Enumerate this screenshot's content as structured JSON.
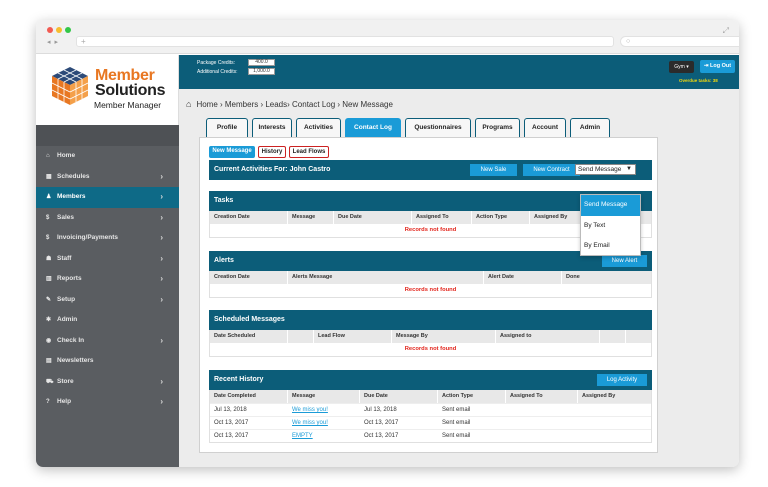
{
  "browser": {
    "nav": [
      "◂",
      "▸"
    ],
    "new_tab": "+",
    "search_icon": "○",
    "expand_icon": "⤢"
  },
  "brand": {
    "line1": "Member",
    "line2": "Solutions",
    "line3": "Member Manager"
  },
  "sidebar": {
    "items": [
      {
        "label": "Home",
        "icon": "home-icon",
        "glyph": "⌂",
        "chevron": false,
        "active": false
      },
      {
        "label": "Schedules",
        "icon": "calendar-icon",
        "glyph": "▦",
        "chevron": true,
        "active": false
      },
      {
        "label": "Members",
        "icon": "user-icon",
        "glyph": "♟",
        "chevron": true,
        "active": true
      },
      {
        "label": "Sales",
        "icon": "dollar-icon",
        "glyph": "$",
        "chevron": true,
        "active": false
      },
      {
        "label": "Invoicing/Payments",
        "icon": "dollar-icon",
        "glyph": "$",
        "chevron": true,
        "active": false
      },
      {
        "label": "Staff",
        "icon": "users-icon",
        "glyph": "☗",
        "chevron": true,
        "active": false
      },
      {
        "label": "Reports",
        "icon": "chart-icon",
        "glyph": "▥",
        "chevron": true,
        "active": false
      },
      {
        "label": "Setup",
        "icon": "wrench-icon",
        "glyph": "✎",
        "chevron": true,
        "active": false
      },
      {
        "label": "Admin",
        "icon": "gear-icon",
        "glyph": "✱",
        "chevron": false,
        "active": false
      },
      {
        "label": "Check In",
        "icon": "check-circle-icon",
        "glyph": "◉",
        "chevron": true,
        "active": false
      },
      {
        "label": "Newsletters",
        "icon": "newspaper-icon",
        "glyph": "▤",
        "chevron": false,
        "active": false
      },
      {
        "label": "Store",
        "icon": "cart-icon",
        "glyph": "⛟",
        "chevron": true,
        "active": false
      },
      {
        "label": "Help",
        "icon": "help-icon",
        "glyph": "?",
        "chevron": true,
        "active": false
      }
    ],
    "chevron_glyph": "›"
  },
  "topbar": {
    "package_label": "Package Credits:",
    "package_value": "400.0",
    "additional_label": "Additional Credits:",
    "additional_value": "1,000.0",
    "gym_label": "Gym ▾",
    "logout_label": "⇥ Log Out",
    "overdue": "Overdue tasks: 38"
  },
  "breadcrumb": {
    "home_glyph": "⌂",
    "path": "Home › Members › Leads› Contact Log › New Message"
  },
  "tabs": [
    "Profile",
    "Interests",
    "Activities",
    "Contact Log",
    "Questionnaires",
    "Programs",
    "Account",
    "Admin"
  ],
  "active_tab": "Contact Log",
  "subtabs": [
    "New Message",
    "History",
    "Lead Flows"
  ],
  "activities": {
    "title": "Current Activities For: John Castro",
    "new_sale": "New Sale",
    "new_contract": "New Contract",
    "dropdown_value": "Send Message",
    "dropdown_arrow": "▼",
    "dropdown_options": [
      "Send Message",
      "By Text",
      "By Email"
    ]
  },
  "tasks": {
    "title": "Tasks",
    "columns": [
      "Creation Date",
      "Message",
      "Due Date",
      "Assigned To",
      "Action Type",
      "Assigned By"
    ],
    "empty": "Records not found"
  },
  "alerts": {
    "title": "Alerts",
    "button": "New Alert",
    "columns": [
      "Creation Date",
      "Alerts Message",
      "Alert Date",
      "Done"
    ],
    "empty": "Records not found"
  },
  "scheduled": {
    "title": "Scheduled Messages",
    "columns": [
      "Date Scheduled",
      "",
      "Lead Flow",
      "Message By",
      "Assigned to"
    ],
    "empty": "Records not found"
  },
  "history": {
    "title": "Recent History",
    "button": "Log Activity",
    "columns": [
      "Date Completed",
      "Message",
      "Due Date",
      "Action Type",
      "Assigned To",
      "Assigned By"
    ],
    "rows": [
      [
        "Jul 13, 2018",
        "We miss you!",
        "Jul 13, 2018",
        "Sent email",
        "",
        ""
      ],
      [
        "Oct 13, 2017",
        "We miss you!",
        "Oct 13, 2017",
        "Sent email",
        "",
        ""
      ],
      [
        "Oct 13, 2017",
        "EMPTY",
        "Oct 13, 2017",
        "Sent email",
        "",
        ""
      ]
    ]
  }
}
